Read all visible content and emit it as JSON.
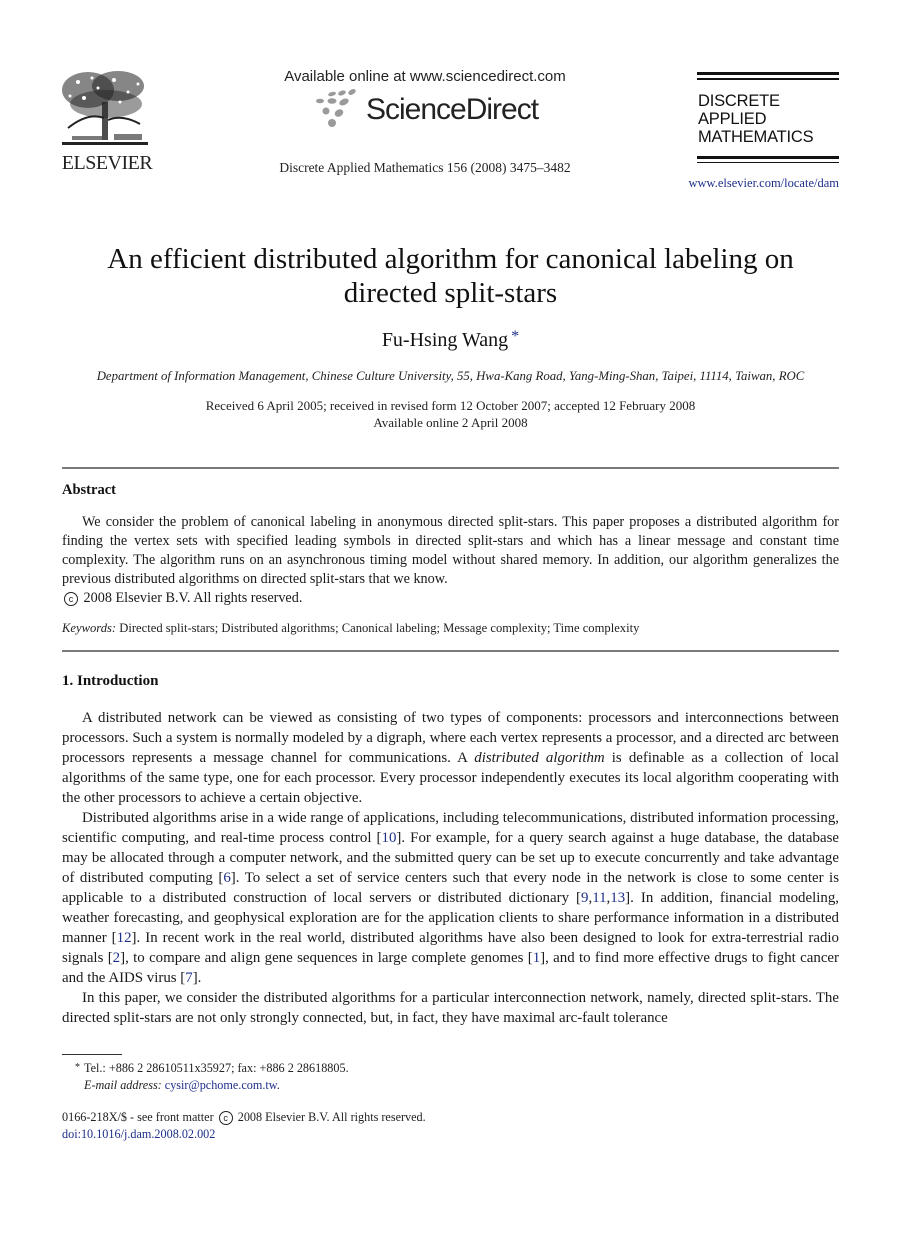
{
  "header": {
    "publisher_name": "ELSEVIER",
    "sciencedirect_available": "Available online at www.sciencedirect.com",
    "sciencedirect_name": "ScienceDirect",
    "journal_citation": "Discrete Applied Mathematics 156 (2008) 3475–3482",
    "journal_title_lines": [
      "DISCRETE",
      "APPLIED",
      "MATHEMATICS"
    ],
    "journal_url": "www.elsevier.com/locate/dam"
  },
  "article": {
    "title": "An efficient distributed algorithm for canonical labeling on directed split-stars",
    "author": "Fu-Hsing Wang",
    "author_marker": "*",
    "affiliation": "Department of Information Management, Chinese Culture University, 55, Hwa-Kang Road, Yang-Ming-Shan, Taipei, 11114, Taiwan, ROC",
    "received": "Received 6 April 2005; received in revised form 12 October 2007; accepted 12 February 2008",
    "available_online": "Available online 2 April 2008"
  },
  "abstract": {
    "heading": "Abstract",
    "text": "We consider the problem of canonical labeling in anonymous directed split-stars. This paper proposes a distributed algorithm for finding the vertex sets with specified leading symbols in directed split-stars and which has a linear message and constant time complexity. The algorithm runs on an asynchronous timing model without shared memory. In addition, our algorithm generalizes the previous distributed algorithms on directed split-stars that we know.",
    "copyright_symbol": "c",
    "copyright_text": "2008 Elsevier B.V. All rights reserved.",
    "keywords_label": "Keywords:",
    "keywords": "Directed split-stars; Distributed algorithms; Canonical labeling; Message complexity; Time complexity"
  },
  "introduction": {
    "heading": "1.  Introduction",
    "p1_a": "A distributed network can be viewed as consisting of two types of components: processors and interconnections between processors. Such a system is normally modeled by a digraph, where each vertex represents a processor, and a directed arc between processors represents a message channel for communications. A ",
    "p1_em": "distributed algorithm",
    "p1_b": " is definable as a collection of local algorithms of the same type, one for each processor. Every processor independently executes its local algorithm cooperating with the other processors to achieve a certain objective.",
    "p2_segments": [
      "Distributed algorithms arise in a wide range of applications, including telecommunications, distributed information processing, scientific computing, and real-time process control [",
      "]. For example, for a query search against a huge database, the database may be allocated through a computer network, and the submitted query can be set up to execute concurrently and take advantage of distributed computing [",
      "]. To select a set of service centers such that every node in the network is close to some center is applicable to a distributed construction of local servers or distributed dictionary [",
      ",",
      ",",
      "]. In addition, financial modeling, weather forecasting, and geophysical exploration are for the application clients to share performance information in a distributed manner [",
      "]. In recent work in the real world, distributed algorithms have also been designed to look for extra-terrestrial radio signals [",
      "], to compare and align gene sequences in large complete genomes [",
      "], and to find more effective drugs to fight cancer and the AIDS virus [",
      "]."
    ],
    "p2_refs": [
      "10",
      "6",
      "9",
      "11",
      "13",
      "12",
      "2",
      "1",
      "7"
    ],
    "p3": "In this paper, we consider the distributed algorithms for a particular interconnection network, namely, directed split-stars. The directed split-stars are not only strongly connected, but, in fact, they have maximal arc-fault tolerance"
  },
  "footnote": {
    "marker": "*",
    "contact": "Tel.: +886 2 28610511x35927; fax: +886 2 28618805.",
    "email_label": "E-mail address:",
    "email": "cysir@pchome.com.tw",
    "email_suffix": "."
  },
  "front_matter": {
    "issn": "0166-218X/$ - see front matter",
    "copyright_symbol": "c",
    "rights": "2008 Elsevier B.V. All rights reserved.",
    "doi": "doi:10.1016/j.dam.2008.02.002"
  }
}
